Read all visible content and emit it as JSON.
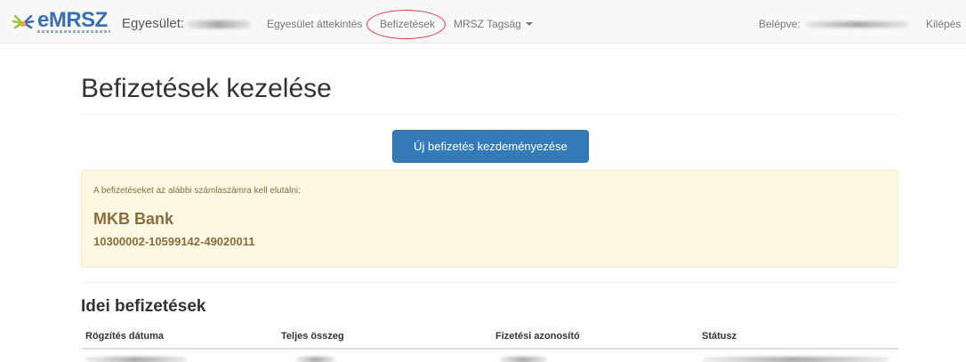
{
  "navbar": {
    "brand": "eMRSZ",
    "club_label": "Egyesület:",
    "links": [
      {
        "label": "Egyesület áttekintés"
      },
      {
        "label": "Befizetések"
      },
      {
        "label": "MRSZ Tagság"
      }
    ],
    "logged_in_label": "Belépve:",
    "logout_label": "Kilépés"
  },
  "page": {
    "title": "Befizetések kezelése",
    "new_payment_button": "Új befizetés kezdeményezése",
    "alert": {
      "note": "A befizetéseket az alábbi számlaszámra kell elutalni:",
      "bank_name": "MKB Bank",
      "account_number": "10300002-10599142-49020011"
    },
    "payments_section_title": "Idei befizetések",
    "table": {
      "columns": [
        "Rögzítés dátuma",
        "Teljes összeg",
        "Fizetési azonosító",
        "Státusz"
      ]
    }
  },
  "colors": {
    "primary": "#337ab7",
    "alert_bg": "#fcf8e3",
    "alert_text": "#8a6d3b",
    "highlight_ring": "#d43b3b"
  }
}
